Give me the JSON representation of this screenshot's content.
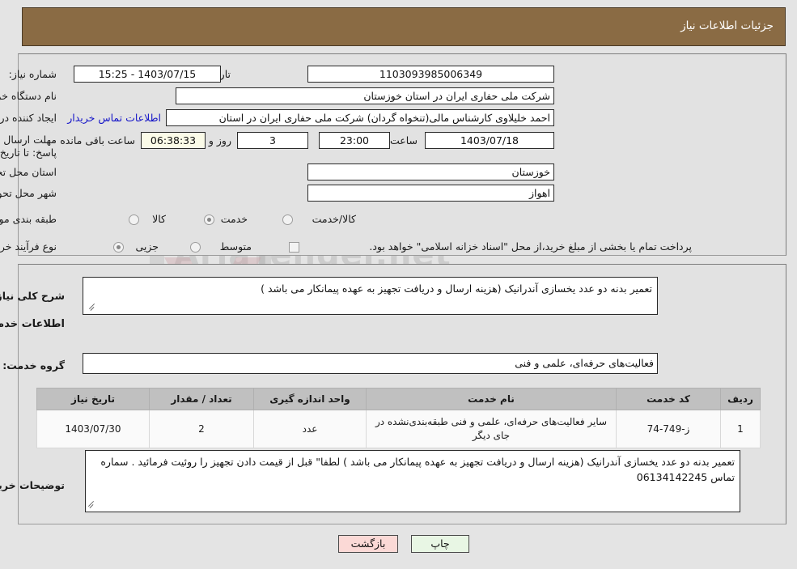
{
  "header": {
    "title": "جزئیات اطلاعات نیاز"
  },
  "top_form": {
    "need_number_label": "شماره نیاز:",
    "need_number_value": "1103093985006349",
    "announce_datetime_label": "تاریخ و ساعت اعلان عمومی:",
    "announce_datetime_value": "1403/07/15 - 15:25",
    "buyer_org_label": "نام دستگاه خریدار:",
    "buyer_org_value": "شرکت ملی حفاری ایران در استان خوزستان",
    "requester_label": "ایجاد کننده درخواست:",
    "requester_value": "احمد خلیلاوی کارشناس مالی(تنخواه گردان) شرکت ملی حفاری ایران در استان",
    "contact_link": "اطلاعات تماس خریدار",
    "deadline_label": "مهلت ارسال پاسخ: تا تاریخ:",
    "deadline_date": "1403/07/18",
    "hour_label": "ساعت",
    "deadline_time": "23:00",
    "days_remaining": "3",
    "day_and_label": "روز و",
    "countdown": "06:38:33",
    "remaining_label": "ساعت باقی مانده",
    "province_label": "استان محل تحویل:",
    "province_value": "خوزستان",
    "city_label": "شهر محل تحویل:",
    "city_value": "اهواز",
    "category_label": "طبقه بندی موضوعی:",
    "category_options": [
      "کالا",
      "خدمت",
      "کالا/خدمت"
    ],
    "category_selected": "خدمت",
    "process_label": "نوع فرآیند خرید :",
    "process_options": [
      "جزیی",
      "متوسط"
    ],
    "process_selected": "جزیی",
    "treasury_checkbox_label": "پرداخت تمام یا بخشی از مبلغ خرید،از محل \"اسناد خزانه اسلامی\" خواهد بود.",
    "treasury_checked": false
  },
  "bottom": {
    "need_desc_label": "شرح کلی نیاز:",
    "need_desc_value": "تعمیر بدنه دو عدد یخسازی آندرانیک (هزینه ارسال و دریافت تجهیز به عهده پیمانکار می باشد )",
    "services_info_heading": "اطلاعات خدمات مورد نیاز",
    "service_group_label": "گروه خدمت:",
    "service_group_value": "فعالیت‌های حرفه‌ای، علمی و فنی",
    "buyer_notes_label": "توضیحات خریدار:",
    "buyer_notes_value": "تعمیر بدنه دو عدد یخسازی آندرانیک (هزینه ارسال و دریافت تجهیز به عهده پیمانکار می باشد ) لطفا\" قبل از قیمت دادن تجهیز را روئیت فرمائید . سماره تماس 06134142245"
  },
  "table": {
    "columns": [
      "ردیف",
      "کد خدمت",
      "نام خدمت",
      "واحد اندازه گیری",
      "تعداد / مقدار",
      "تاریخ نیاز"
    ],
    "rows": [
      {
        "row_no": "1",
        "service_code": "ز-749-74",
        "service_name": "سایر فعالیت‌های حرفه‌ای، علمی و فنی طبقه‌بندی‌نشده در جای دیگر",
        "unit": "عدد",
        "quantity": "2",
        "need_date": "1403/07/30"
      }
    ]
  },
  "footer": {
    "print_label": "چاپ",
    "back_label": "بازگشت"
  },
  "watermark": {
    "text1": "AriaTender.net",
    "text2": "AriaTender.net"
  },
  "colors": {
    "header_bg": "#8a6b44",
    "page_bg": "#e4e4e4",
    "panel_bg": "#e2e2e2",
    "link": "#1414c8",
    "timer_bg": "#fbfbe8",
    "print_btn": "#e8f6e4",
    "back_btn": "#fbd9d6",
    "table_header": "#c0c0c0"
  }
}
